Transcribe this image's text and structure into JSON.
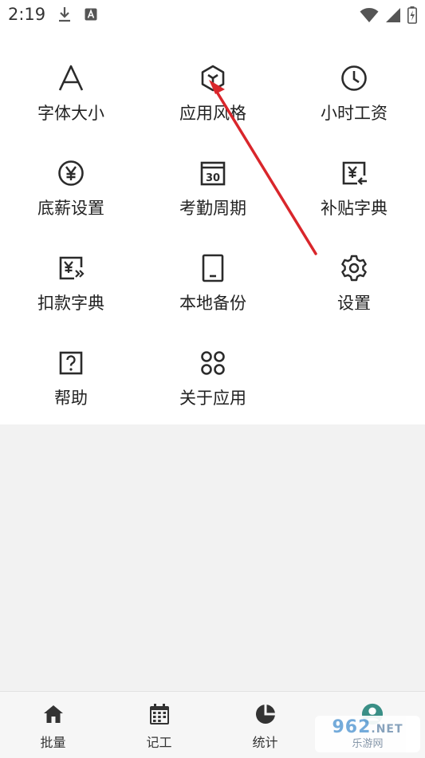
{
  "status_bar": {
    "time": "2:19"
  },
  "menu": {
    "items": [
      {
        "label": "字体大小",
        "icon": "font-size-icon"
      },
      {
        "label": "应用风格",
        "icon": "hexagon-style-icon"
      },
      {
        "label": "小时工资",
        "icon": "clock-icon"
      },
      {
        "label": "底薪设置",
        "icon": "yen-circle-icon"
      },
      {
        "label": "考勤周期",
        "icon": "calendar-30-icon"
      },
      {
        "label": "补贴字典",
        "icon": "yen-add-icon"
      },
      {
        "label": "扣款字典",
        "icon": "yen-deduct-icon"
      },
      {
        "label": "本地备份",
        "icon": "tablet-icon"
      },
      {
        "label": "设置",
        "icon": "gear-icon"
      },
      {
        "label": "帮助",
        "icon": "help-icon"
      },
      {
        "label": "关于应用",
        "icon": "four-dots-icon"
      }
    ]
  },
  "bottom_nav": {
    "items": [
      {
        "label": "批量",
        "icon": "home-icon"
      },
      {
        "label": "记工",
        "icon": "calendar-icon"
      },
      {
        "label": "统计",
        "icon": "pie-chart-icon"
      },
      {
        "label": "",
        "icon": "profile-icon"
      }
    ]
  },
  "watermark": {
    "text_top": "962",
    "text_top_suffix": ".NET",
    "text_bottom": "乐游网"
  },
  "colors": {
    "arrow": "#d9262b",
    "icon": "#2b2b2b",
    "panel": "#ffffff",
    "background": "#f2f2f2",
    "profile_accent": "#3a8f86"
  }
}
